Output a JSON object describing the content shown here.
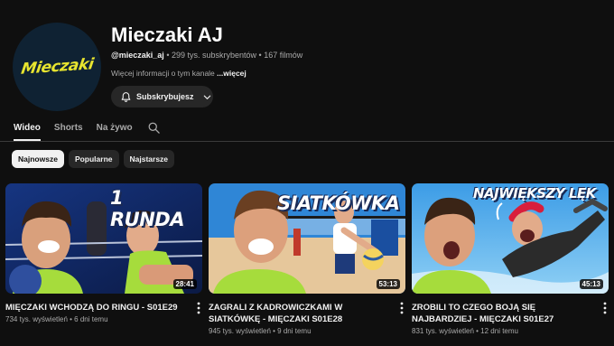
{
  "channel": {
    "name": "Mieczaki AJ",
    "handle": "@mieczaki_aj",
    "subscribers": "299 tys. subskrybentów",
    "videos_count": "167 filmów",
    "separator": " • ",
    "description": "Więcej informacji o tym kanale",
    "more": "...więcej",
    "logo_text": "Mieczaki",
    "subscribe_label": "Subskrybujesz"
  },
  "tabs": [
    {
      "label": "Wideo",
      "active": true
    },
    {
      "label": "Shorts",
      "active": false
    },
    {
      "label": "Na żywo",
      "active": false
    }
  ],
  "chips": [
    {
      "label": "Najnowsze",
      "active": true
    },
    {
      "label": "Popularne",
      "active": false
    },
    {
      "label": "Najstarsze",
      "active": false
    }
  ],
  "videos": [
    {
      "title": "MIĘCZAKI WCHODZĄ DO RINGU - S01E29",
      "views": "734 tys. wyświetleń",
      "age": "6 dni temu",
      "duration": "28:41",
      "thumb_text": "1 RUNDA"
    },
    {
      "title": "ZAGRALI Z KADROWICZKAMI W SIATKÓWKĘ - MIĘCZAKI S01E28",
      "views": "945 tys. wyświetleń",
      "age": "9 dni temu",
      "duration": "53:13",
      "thumb_text": "SIATKÓWKA"
    },
    {
      "title": "ZROBILI TO CZEGO BOJĄ SIĘ NAJBARDZIEJ - MIĘCZAKI S01E27",
      "views": "831 tys. wyświetleń",
      "age": "12 dni temu",
      "duration": "45:13",
      "thumb_text": "NAJWIĘKSZY LĘK"
    }
  ],
  "colors": {
    "background": "#0f0f0f",
    "logo_yellow": "#e8e52f",
    "jersey_green": "#a6dc3c",
    "thumb1_bg": "#1c3c8c",
    "thumb2_sky": "#2f86d6",
    "thumb3_sky": "#46a6ea"
  },
  "icons": [
    "bell-icon",
    "chevron-down-icon",
    "search-icon",
    "more-vert-icon"
  ]
}
